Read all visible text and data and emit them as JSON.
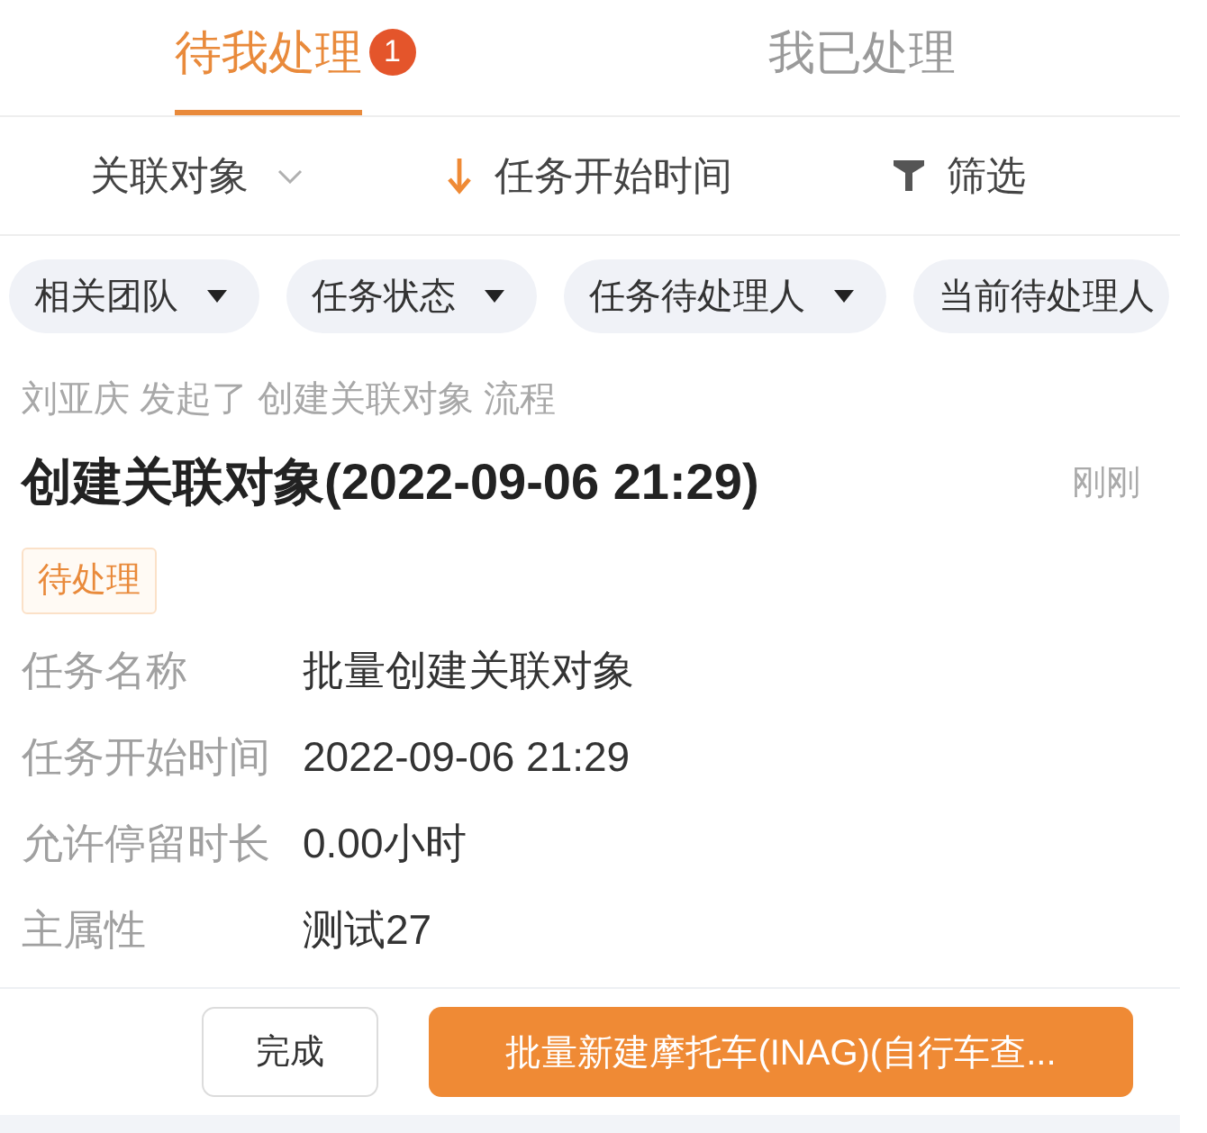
{
  "tabs": [
    {
      "label": "待我处理",
      "selected": true,
      "badge": "1"
    },
    {
      "label": "我已处理",
      "selected": false
    }
  ],
  "sort_bar": [
    {
      "kind": "dropdown",
      "label": "关联对象"
    },
    {
      "kind": "sort",
      "label": "任务开始时间"
    },
    {
      "kind": "filter",
      "label": "筛选"
    }
  ],
  "filter_chips": [
    {
      "label": "相关团队",
      "caret": true
    },
    {
      "label": "任务状态",
      "caret": true
    },
    {
      "label": "任务待处理人",
      "caret": true
    },
    {
      "label": "当前待处理人",
      "caret": false
    }
  ],
  "task": {
    "initiator_line": "刘亚庆 发起了 创建关联对象 流程",
    "title": "创建关联对象(2022-09-06 21:29)",
    "time": "刚刚",
    "status": "待处理",
    "fields": [
      {
        "label": "任务名称",
        "value": "批量创建关联对象"
      },
      {
        "label": "任务开始时间",
        "value": "2022-09-06 21:29"
      },
      {
        "label": "允许停留时长",
        "value": "0.00小时"
      },
      {
        "label": "主属性",
        "value": "测试27"
      }
    ]
  },
  "actions": [
    {
      "kind": "secondary",
      "label": "完成"
    },
    {
      "kind": "primary",
      "label": "批量新建摩托车(INAG)(自行车查..."
    }
  ]
}
